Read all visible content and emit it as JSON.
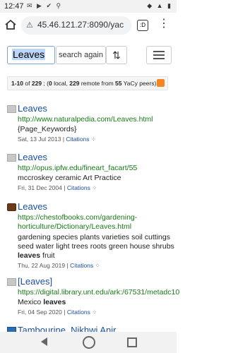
{
  "status": {
    "time": "12:47",
    "left_icons": "✉ ▶ ✔ ⚲",
    "right_icons": "◆ ▲ ▮"
  },
  "browser": {
    "url": "45.46.121.27:8090/yac",
    "tab_count": ":D"
  },
  "search": {
    "query": "Leaves",
    "button_label": "search again",
    "sort_glyph": "⇅"
  },
  "summary": {
    "range": "1-10",
    "of": "of",
    "total": "229",
    "sep": " ; (",
    "local": "0",
    "local_label": " local, ",
    "remote": "229",
    "remote_label": " remote from ",
    "peers": "55",
    "peers_label": " YaCy peers)."
  },
  "results": [
    {
      "icon": "page-icon",
      "title": "Leaves",
      "url": "http://www.naturalpedia.com/Leaves.html",
      "description": "{Page_Keywords}",
      "date": "Sat, 13 Jul 2013",
      "citations": "Citations",
      "pipe": "|"
    },
    {
      "icon": "page-icon",
      "title": "Leaves",
      "url": "http://opus.ipfw.edu/fineart_facart/55",
      "description": "mccroskey ceramic Art Practice",
      "date": "Fri, 31 Dec 2004",
      "citations": "Citations",
      "pipe": "|"
    },
    {
      "icon": "book-icon",
      "title": "Leaves",
      "url_line1": "https://chestofbooks.com/gardening-",
      "url_line2": "horticulture/Dictionary/Leaves.html",
      "desc_line1": "gardening species plants varieties soil cuttings",
      "desc_line2": "seed water light trees roots green house shrubs",
      "desc_bold": "leaves",
      "desc_tail": " fruit",
      "date": "Thu, 22 Aug 2019",
      "citations": "Citations",
      "pipe": "|"
    },
    {
      "icon": "page-icon",
      "title": "[Leaves]",
      "url": "https://digital.library.unt.edu/ark:/67531/metadc10",
      "desc_pre": "Mexico ",
      "desc_bold": "leaves",
      "date": "Fri, 04 Sep 2020",
      "citations": "Citations",
      "pipe": "|"
    },
    {
      "icon": "blue-icon",
      "title": "Tambourine, Nikhwi Anir"
    }
  ]
}
